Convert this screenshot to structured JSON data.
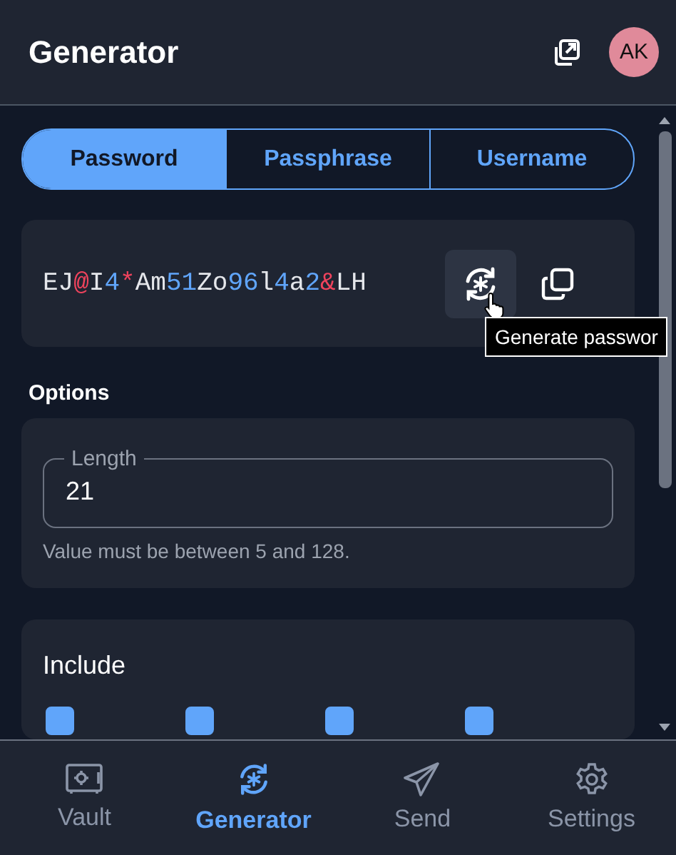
{
  "header": {
    "title": "Generator",
    "avatar": "AK"
  },
  "tabs": [
    {
      "label": "Password",
      "selected": true
    },
    {
      "label": "Passphrase",
      "selected": false
    },
    {
      "label": "Username",
      "selected": false
    }
  ],
  "password": [
    {
      "text": "EJ",
      "kind": "letter"
    },
    {
      "text": "@",
      "kind": "special"
    },
    {
      "text": "I",
      "kind": "letter"
    },
    {
      "text": "4",
      "kind": "digit"
    },
    {
      "text": "*",
      "kind": "special"
    },
    {
      "text": "Am",
      "kind": "letter"
    },
    {
      "text": "51",
      "kind": "digit"
    },
    {
      "text": "Zo",
      "kind": "letter"
    },
    {
      "text": "96",
      "kind": "digit"
    },
    {
      "text": "l",
      "kind": "letter"
    },
    {
      "text": "4",
      "kind": "digit"
    },
    {
      "text": "a",
      "kind": "letter"
    },
    {
      "text": "2",
      "kind": "digit"
    },
    {
      "text": "&",
      "kind": "special"
    },
    {
      "text": "LH",
      "kind": "letter"
    }
  ],
  "tooltip": "Generate passwor",
  "options": {
    "heading": "Options",
    "length_label": "Length",
    "length_value": "21",
    "length_hint": "Value must be between 5 and 128."
  },
  "include": {
    "heading": "Include",
    "checkboxes": [
      {
        "checked": true
      },
      {
        "checked": true
      },
      {
        "checked": true
      },
      {
        "checked": true
      }
    ]
  },
  "nav": [
    {
      "label": "Vault",
      "kind": "vault",
      "selected": false
    },
    {
      "label": "Generator",
      "kind": "generator",
      "selected": true
    },
    {
      "label": "Send",
      "kind": "send",
      "selected": false
    },
    {
      "label": "Settings",
      "kind": "settings",
      "selected": false
    }
  ]
}
